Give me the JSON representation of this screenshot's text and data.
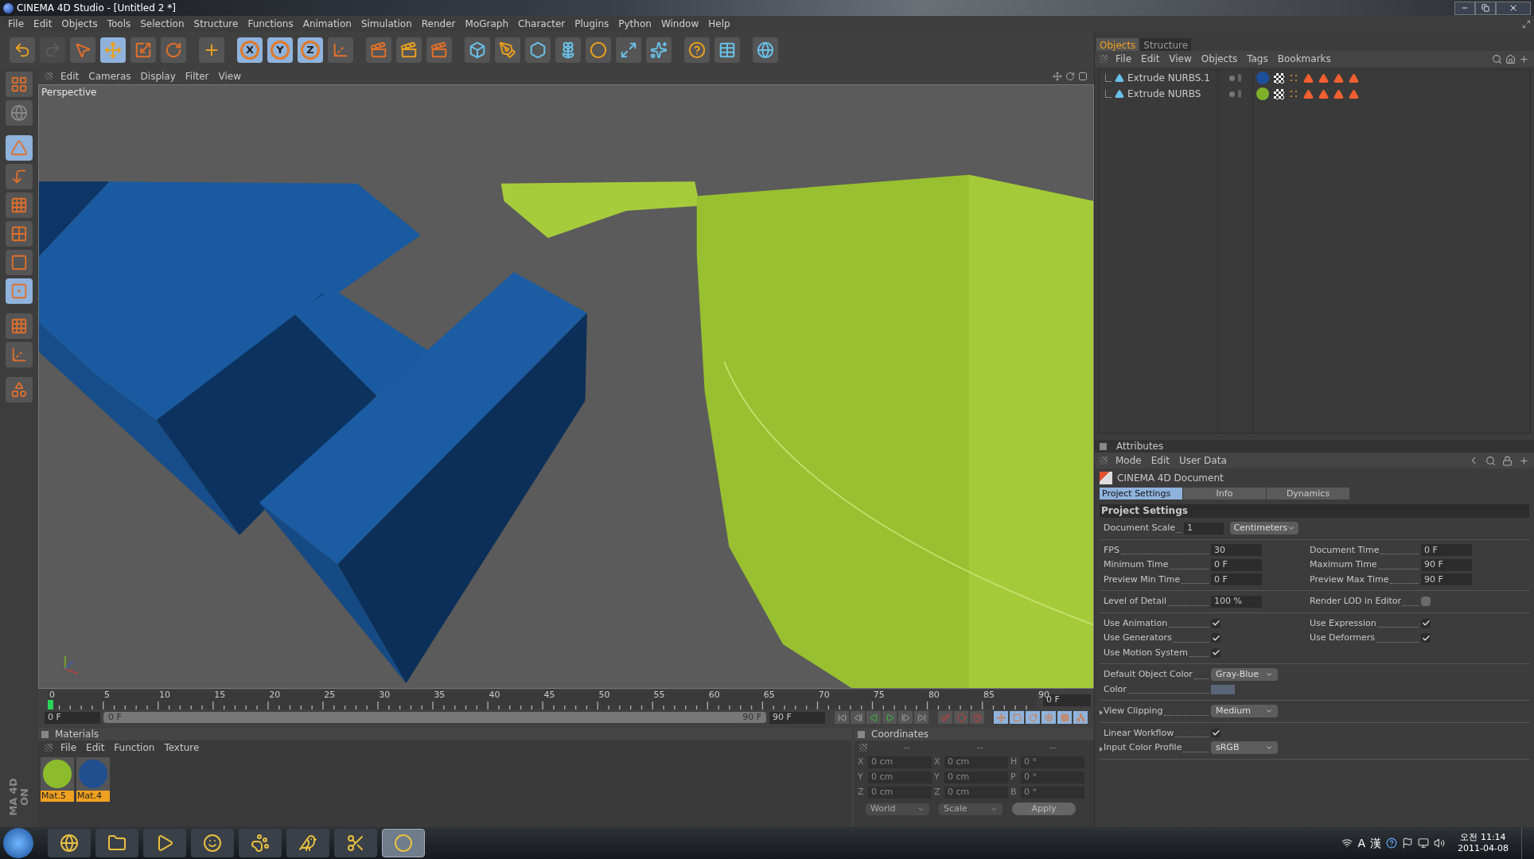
{
  "window": {
    "title": "CINEMA 4D Studio - [Untitled 2 *]"
  },
  "menu": [
    "File",
    "Edit",
    "Objects",
    "Tools",
    "Selection",
    "Structure",
    "Functions",
    "Animation",
    "Simulation",
    "Render",
    "MoGraph",
    "Character",
    "Plugins",
    "Python",
    "Window",
    "Help"
  ],
  "toolbar": [
    {
      "selected": false,
      "disabled": false
    },
    {
      "selected": false,
      "disabled": true
    },
    {
      "selected": false,
      "disabled": false
    },
    {
      "selected": true,
      "disabled": false
    },
    {
      "selected": false,
      "disabled": false
    },
    {
      "selected": false,
      "disabled": false
    },
    {
      "selected": false,
      "disabled": false
    },
    {
      "label": "X",
      "selected": true,
      "disabled": false
    },
    {
      "label": "Y",
      "selected": true,
      "disabled": false
    },
    {
      "label": "Z",
      "selected": true,
      "disabled": false
    },
    {
      "selected": false,
      "disabled": false
    },
    {
      "selected": false,
      "disabled": false
    },
    {
      "selected": false,
      "disabled": false
    },
    {
      "selected": false,
      "disabled": false
    },
    {
      "selected": false,
      "disabled": false
    },
    {
      "selected": false,
      "disabled": false
    },
    {
      "selected": false,
      "disabled": false
    },
    {
      "selected": false,
      "disabled": false
    },
    {
      "selected": false,
      "disabled": false
    },
    {
      "selected": false,
      "disabled": false
    },
    {
      "selected": false,
      "disabled": false
    },
    {
      "selected": false,
      "disabled": false
    },
    {
      "selected": false,
      "disabled": false
    },
    {
      "selected": false,
      "disabled": false
    }
  ],
  "left_toolbar": [
    {
      "selected": false
    },
    {
      "selected": false
    },
    {
      "selected": true
    },
    {
      "selected": false
    },
    {
      "selected": false
    },
    {
      "selected": false
    },
    {
      "selected": false
    },
    {
      "selected": true
    },
    {
      "selected": false
    },
    {
      "selected": false
    },
    {
      "selected": false
    }
  ],
  "left_logo": [
    "ON",
    "MA 4D"
  ],
  "viewport": {
    "menu": [
      "Edit",
      "Cameras",
      "Display",
      "Filter",
      "View"
    ],
    "camera": "Perspective"
  },
  "timeline": {
    "ticks": [
      "0",
      "5",
      "10",
      "15",
      "20",
      "25",
      "30",
      "35",
      "40",
      "45",
      "50",
      "55",
      "60",
      "65",
      "70",
      "75",
      "80",
      "85",
      "90"
    ],
    "current_frame": "0 F",
    "start": "0 F",
    "range_start": "0 F",
    "range_end": "90 F",
    "level": 1,
    "end": "90 F"
  },
  "materials": {
    "title": "Materials",
    "menu": [
      "File",
      "Edit",
      "Function",
      "Texture"
    ],
    "items": [
      {
        "name": "Mat.5",
        "color": "#8cbc2c"
      },
      {
        "name": "Mat.4",
        "color": "#1f4f8f"
      }
    ]
  },
  "coordinates": {
    "title": "Coordinates",
    "disabled": true,
    "headers": [
      "--",
      "--",
      "--"
    ],
    "rows": [
      {
        "axis": "X",
        "position": "0 cm",
        "size_axis": "X",
        "size": "0 cm",
        "rot_axis": "H",
        "rotation": "0 °"
      },
      {
        "axis": "Y",
        "position": "0 cm",
        "size_axis": "Y",
        "size": "0 cm",
        "rot_axis": "P",
        "rotation": "0 °"
      },
      {
        "axis": "Z",
        "position": "0 cm",
        "size_axis": "Z",
        "size": "0 cm",
        "rot_axis": "B",
        "rotation": "0 °"
      }
    ],
    "mode": "World",
    "size_mode": "Scale",
    "apply": "Apply"
  },
  "objects_panel": {
    "tabs": [
      {
        "label": "Objects",
        "selected": true
      },
      {
        "label": "Structure",
        "selected": false
      }
    ],
    "menu": [
      "File",
      "Edit",
      "View",
      "Objects",
      "Tags",
      "Bookmarks"
    ],
    "objects": [
      {
        "name": "Extrude NURBS.1",
        "color": "#1d4f9a"
      },
      {
        "name": "Extrude NURBS",
        "color": "#7fb02a"
      }
    ]
  },
  "attributes": {
    "title": "Attributes",
    "menu": [
      "Mode",
      "Edit",
      "User Data"
    ],
    "object": "CINEMA 4D Document",
    "tabs": [
      {
        "label": "Project Settings",
        "selected": true
      },
      {
        "label": "Info",
        "selected": false
      },
      {
        "label": "Dynamics",
        "selected": false
      }
    ],
    "section": "Project Settings",
    "groups": [
      [
        {
          "left": {
            "kind": "field",
            "label": "Document Scale",
            "value": "1",
            "unit": "Centimeters"
          }
        }
      ],
      [
        {
          "left": {
            "kind": "field",
            "label": "FPS",
            "value": "30"
          },
          "right": {
            "kind": "field",
            "label": "Document Time",
            "value": "0 F"
          }
        },
        {
          "left": {
            "kind": "field",
            "label": "Minimum Time",
            "value": "0 F"
          },
          "right": {
            "kind": "field",
            "label": "Maximum Time",
            "value": "90 F"
          }
        },
        {
          "left": {
            "kind": "field",
            "label": "Preview Min Time",
            "value": "0 F"
          },
          "right": {
            "kind": "field",
            "label": "Preview Max Time",
            "value": "90 F"
          }
        }
      ],
      [
        {
          "left": {
            "kind": "field",
            "label": "Level of Detail",
            "value": "100 %"
          },
          "right": {
            "kind": "check",
            "label": "Render LOD in Editor",
            "checked": false
          }
        }
      ],
      [
        {
          "left": {
            "kind": "check",
            "label": "Use Animation",
            "checked": true
          },
          "right": {
            "kind": "check",
            "label": "Use Expression",
            "checked": true
          }
        },
        {
          "left": {
            "kind": "check",
            "label": "Use Generators",
            "checked": true
          },
          "right": {
            "kind": "check",
            "label": "Use Deformers",
            "checked": true
          }
        },
        {
          "left": {
            "kind": "check",
            "label": "Use Motion System",
            "checked": true
          }
        }
      ],
      [
        {
          "left": {
            "kind": "dropdown",
            "label": "Default Object Color",
            "value": "Gray-Blue"
          }
        },
        {
          "left": {
            "kind": "color",
            "label": "Color",
            "color": "#5a6577"
          }
        }
      ],
      [
        {
          "left": {
            "kind": "dropdown",
            "label": "View Clipping",
            "value": "Medium",
            "expander": true
          }
        }
      ],
      [
        {
          "left": {
            "kind": "check",
            "label": "Linear Workflow",
            "checked": true
          }
        },
        {
          "left": {
            "kind": "dropdown",
            "label": "Input Color Profile",
            "value": "sRGB",
            "expander": true
          }
        }
      ]
    ]
  },
  "taskbar": {
    "apps": [
      {
        "selected": false
      },
      {
        "selected": false
      },
      {
        "selected": false
      },
      {
        "selected": false
      },
      {
        "selected": false
      },
      {
        "selected": false
      },
      {
        "selected": false
      },
      {
        "selected": true
      }
    ],
    "tray": [
      "A",
      "漢"
    ],
    "time": "오전 11:14",
    "date": "2011-04-08"
  }
}
